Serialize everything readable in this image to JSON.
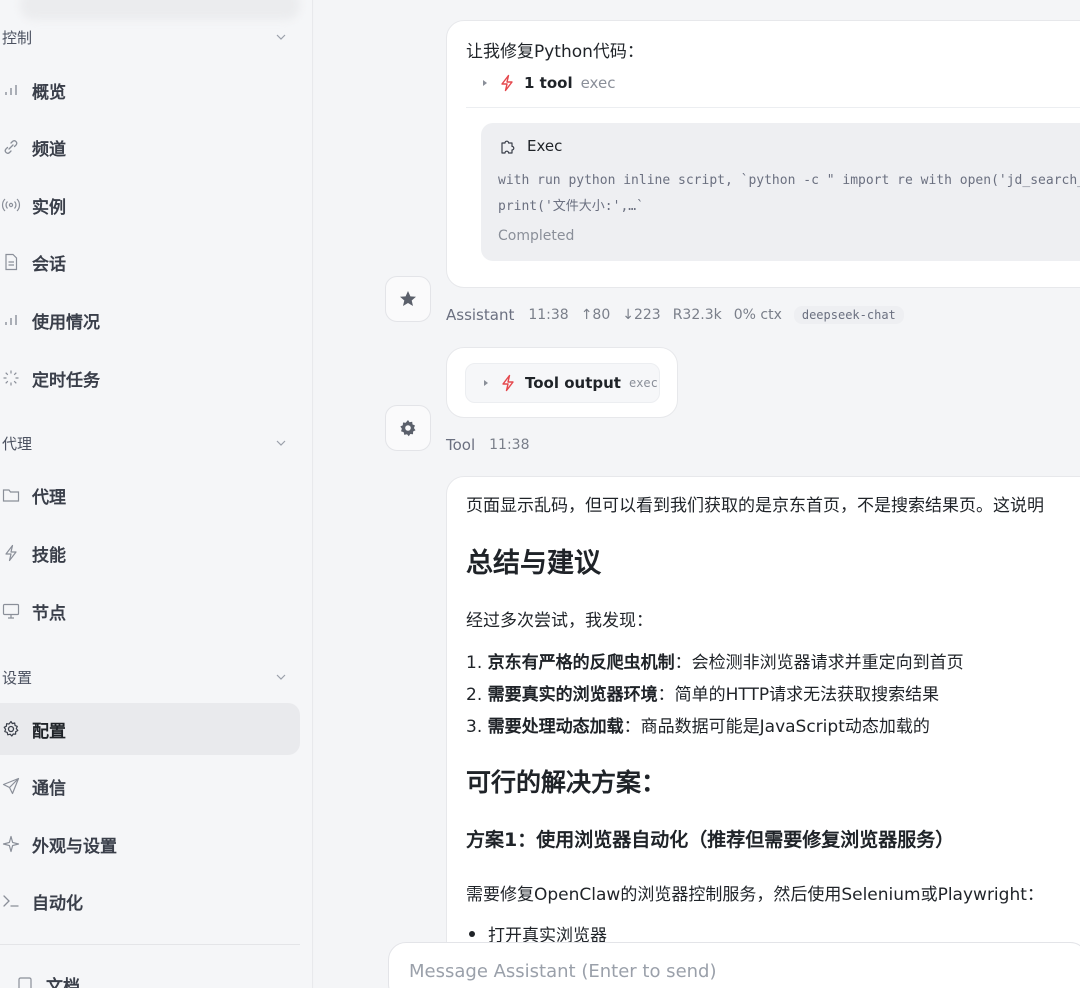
{
  "sidebar": {
    "sections": [
      {
        "label": "控制"
      },
      {
        "label": "代理"
      },
      {
        "label": "设置"
      }
    ],
    "items": [
      {
        "label": "概览",
        "icon": "bar-chart-icon"
      },
      {
        "label": "频道",
        "icon": "link-icon"
      },
      {
        "label": "实例",
        "icon": "broadcast-icon"
      },
      {
        "label": "会话",
        "icon": "document-icon"
      },
      {
        "label": "使用情况",
        "icon": "bar-chart-icon"
      },
      {
        "label": "定时任务",
        "icon": "loader-icon"
      },
      {
        "label": "代理",
        "icon": "folder-icon"
      },
      {
        "label": "技能",
        "icon": "bolt-icon"
      },
      {
        "label": "节点",
        "icon": "monitor-icon"
      },
      {
        "label": "配置",
        "icon": "gear-icon",
        "active": true
      },
      {
        "label": "通信",
        "icon": "send-icon"
      },
      {
        "label": "外观与设置",
        "icon": "sparkle-icon"
      },
      {
        "label": "自动化",
        "icon": "terminal-icon"
      },
      {
        "label": "文档",
        "icon": "book-icon"
      }
    ]
  },
  "chat": {
    "msg1": {
      "intro": "让我修复Python代码：",
      "tool_summary": "1 tool",
      "tool_name": "exec",
      "exec_title": "Exec",
      "exec_line1": "with run python inline script, `python -c \" import re with open('jd_search_",
      "exec_line2": "print('文件大小:',…`",
      "exec_status": "Completed",
      "meta": {
        "role": "Assistant",
        "time": "11:38",
        "up": "↑80",
        "down": "↓223",
        "r": "R32.3k",
        "ctx": "0% ctx",
        "model": "deepseek-chat"
      }
    },
    "msg2": {
      "label": "Tool output",
      "tool_name": "exec",
      "meta": {
        "role": "Tool",
        "time": "11:38"
      }
    },
    "msg3": {
      "p1": "页面显示乱码，但可以看到我们获取的是京东首页，不是搜索结果页。这说明",
      "h1": "总结与建议",
      "p2": "经过多次尝试，我发现：",
      "list": [
        {
          "num": "1.",
          "bold": "京东有严格的反爬虫机制",
          "rest": "：会检测非浏览器请求并重定向到首页"
        },
        {
          "num": "2.",
          "bold": "需要真实的浏览器环境",
          "rest": "：简单的HTTP请求无法获取搜索结果"
        },
        {
          "num": "3.",
          "bold": "需要处理动态加载",
          "rest": "：商品数据可能是JavaScript动态加载的"
        }
      ],
      "h2": "可行的解决方案：",
      "h3": "方案1：使用浏览器自动化（推荐但需要修复浏览器服务）",
      "p3": "需要修复OpenClaw的浏览器控制服务，然后使用Selenium或Playwright：",
      "bullets": [
        "打开真实浏览器"
      ]
    }
  },
  "input": {
    "placeholder": "Message Assistant (Enter to send)"
  },
  "colors": {
    "accent_red": "#e5484d",
    "sidebar_bg": "#f5f6f8",
    "card_bg": "#ffffff"
  }
}
